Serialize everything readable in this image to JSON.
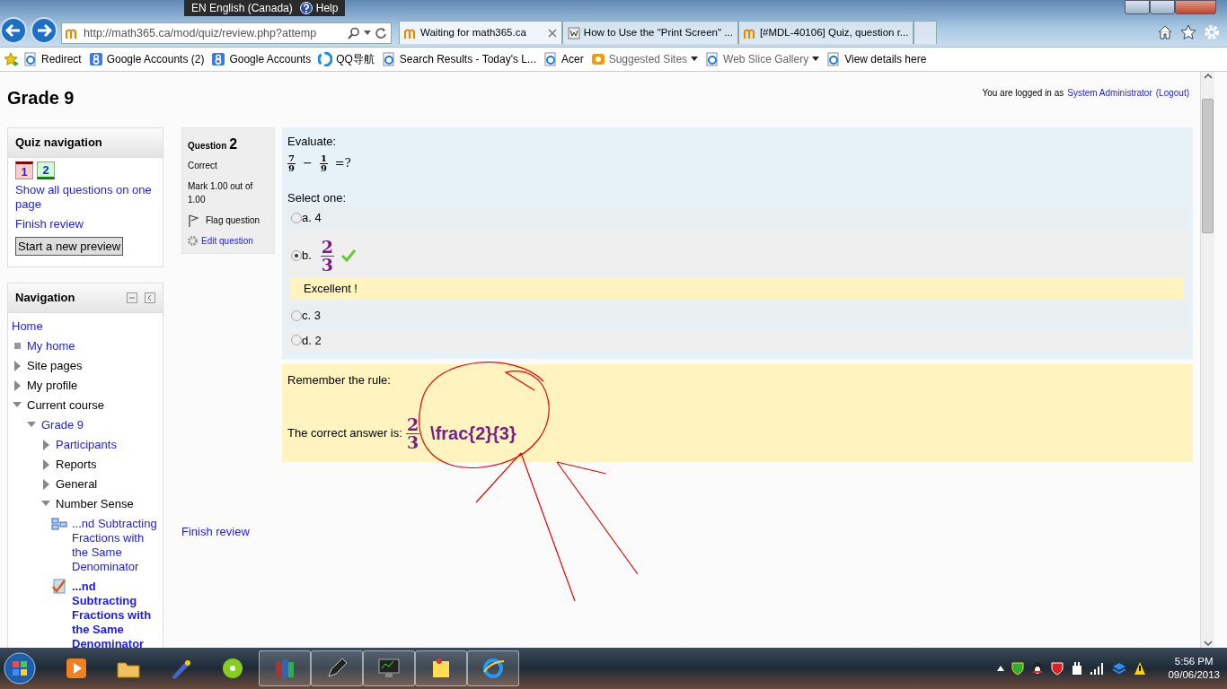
{
  "browser": {
    "language": "EN English (Canada)",
    "help": "Help",
    "address": "http://math365.ca/mod/quiz/review.php?attemp",
    "tabs": [
      {
        "title": "Waiting for math365.ca",
        "selected": true,
        "kind": "moodle"
      },
      {
        "title": "How to Use the \"Print Screen\" ...",
        "selected": false,
        "kind": "wikihow"
      },
      {
        "title": "[#MDL-40106] Quiz, question r...",
        "selected": false,
        "kind": "moodle"
      }
    ]
  },
  "favorites": [
    {
      "label": "Redirect",
      "kind": "page",
      "dropdown": false,
      "dimmed": false
    },
    {
      "label": "Google Accounts (2)",
      "kind": "google",
      "dropdown": false,
      "dimmed": false
    },
    {
      "label": "Google Accounts",
      "kind": "google",
      "dropdown": false,
      "dimmed": false
    },
    {
      "label": "QQ导航",
      "kind": "qq",
      "dropdown": false,
      "dimmed": false
    },
    {
      "label": "Search Results - Today's L...",
      "kind": "page",
      "dropdown": false,
      "dimmed": false
    },
    {
      "label": "Acer",
      "kind": "page",
      "dropdown": false,
      "dimmed": false
    },
    {
      "label": "Suggested Sites",
      "kind": "suggested",
      "dropdown": true,
      "dimmed": true
    },
    {
      "label": "Web Slice Gallery",
      "kind": "page",
      "dropdown": true,
      "dimmed": true
    },
    {
      "label": "View details here",
      "kind": "page",
      "dropdown": false,
      "dimmed": false
    }
  ],
  "page": {
    "title": "Grade 9",
    "login": {
      "prefix": "You are logged in as",
      "user": "System Administrator",
      "logout": "(Logout)"
    }
  },
  "quiz_nav": {
    "title": "Quiz navigation",
    "questions": [
      {
        "number": "1",
        "correct": false
      },
      {
        "number": "2",
        "correct": true
      }
    ],
    "links": [
      "Show all questions on one page",
      "Finish review"
    ],
    "button": "Start a new preview"
  },
  "navigation": {
    "title": "Navigation",
    "items": [
      {
        "label": "Home",
        "link": true,
        "current": false
      },
      {
        "label": "My home",
        "link": true,
        "current": false,
        "kind": "bullet"
      },
      {
        "label": "Site pages",
        "link": false,
        "current": false,
        "expanded": false
      },
      {
        "label": "My profile",
        "link": false,
        "current": false,
        "expanded": false
      },
      {
        "label": "Current course",
        "link": false,
        "current": false,
        "expanded": true,
        "children": [
          {
            "label": "Grade 9",
            "link": true,
            "current": false,
            "expanded": true,
            "children": [
              {
                "label": "Participants",
                "link": true,
                "current": false,
                "expanded": false
              },
              {
                "label": "Reports",
                "link": false,
                "current": false,
                "expanded": false
              },
              {
                "label": "General",
                "link": false,
                "current": false,
                "expanded": false
              },
              {
                "label": "Number Sense",
                "link": false,
                "current": false,
                "expanded": true,
                "children": [
                  {
                    "label": "...nd Subtracting Fractions with the Same Denominator",
                    "link": true,
                    "current": false,
                    "kind": "lesson"
                  },
                  {
                    "label": "...nd Subtracting Fractions with the Same Denominator",
                    "link": true,
                    "current": true,
                    "kind": "quiz"
                  }
                ]
              }
            ]
          }
        ]
      }
    ]
  },
  "question_info": {
    "label": "Question",
    "number": "2",
    "state": "Correct",
    "mark": "Mark 1.00 out of 1.00",
    "flag": "Flag question",
    "edit": "Edit question"
  },
  "question": {
    "prompt": "Evaluate:",
    "formula": [
      {
        "kind": "frac",
        "numerator": "7",
        "denominator": "9"
      },
      {
        "kind": "op",
        "text": "−"
      },
      {
        "kind": "frac",
        "numerator": "1",
        "denominator": "9"
      },
      {
        "kind": "op",
        "text": "=?"
      }
    ],
    "select_label": "Select one:",
    "options": [
      {
        "letter": "a.",
        "kind": "text",
        "text": "4",
        "selected": false,
        "correct": false
      },
      {
        "letter": "b.",
        "kind": "fraction",
        "numerator": "2",
        "denominator": "3",
        "selected": true,
        "correct": true,
        "feedback": "Excellent !"
      },
      {
        "letter": "c.",
        "kind": "text",
        "text": "3",
        "selected": false,
        "correct": false
      },
      {
        "letter": "d.",
        "kind": "text",
        "text": "2",
        "selected": false,
        "correct": false
      }
    ]
  },
  "general_feedback": {
    "intro": "Remember the rule:",
    "answer_label": "The correct answer is:",
    "answer_fraction": {
      "numerator": "2",
      "denominator": "3"
    },
    "answer_latex": "\\frac{2}{3}"
  },
  "finish_review": "Finish review",
  "taskbar": {
    "apps": [
      {
        "kind": "media",
        "running": false
      },
      {
        "kind": "folder",
        "running": false
      },
      {
        "kind": "paint",
        "running": false
      },
      {
        "kind": "music",
        "running": false
      },
      {
        "kind": "archive",
        "running": true
      },
      {
        "kind": "pen",
        "running": true
      },
      {
        "kind": "monitor",
        "running": true
      },
      {
        "kind": "note",
        "running": true
      },
      {
        "kind": "browser",
        "running": true
      }
    ],
    "time": "5:56 PM",
    "date": "09/06/2013"
  }
}
